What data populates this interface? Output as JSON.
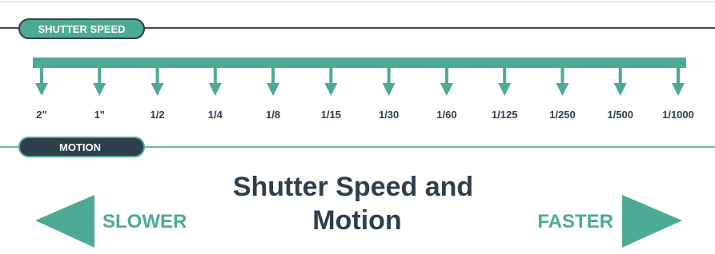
{
  "header": {
    "shutter_speed_label": "SHUTTER SPEED",
    "motion_label": "MOTION"
  },
  "scale": {
    "ticks": [
      "2\"",
      "1\"",
      "1/2",
      "1/4",
      "1/8",
      "1/15",
      "1/30",
      "1/60",
      "1/125",
      "1/250",
      "1/500",
      "1/1000"
    ]
  },
  "title": {
    "line1": "Shutter Speed and",
    "line2": "Motion"
  },
  "directions": {
    "left_label": "SLOWER",
    "right_label": "FASTER"
  },
  "colors": {
    "teal": "#4daa95",
    "dark": "#2f3e4b",
    "line_teal": "#6bb7a6",
    "line_dark": "#3b4a57",
    "white": "#ffffff"
  }
}
